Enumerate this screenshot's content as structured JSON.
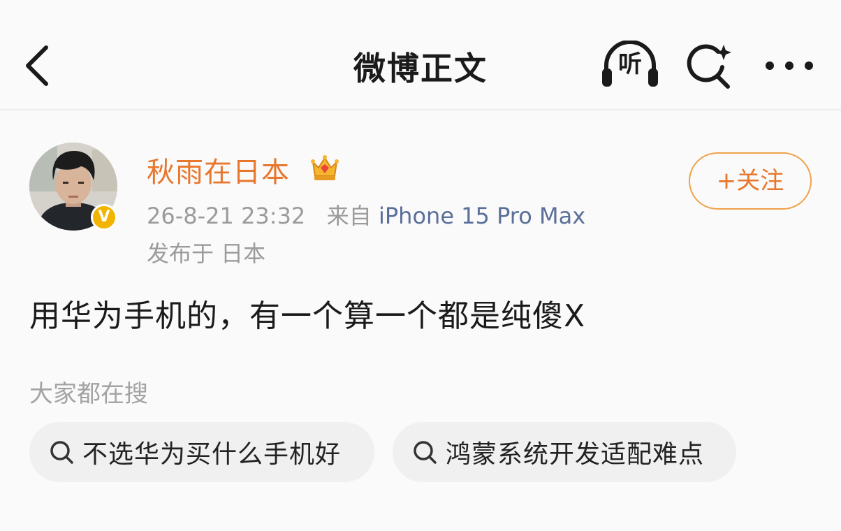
{
  "nav": {
    "title": "微博正文",
    "listen_label": "听"
  },
  "author": {
    "name": "秋雨在日本",
    "verified_mark": "V",
    "timestamp": "26-8-21 23:32",
    "source_prefix": "来自",
    "source_device": "iPhone 15 Pro Max",
    "location": "发布于 日本",
    "follow_label": "+关注"
  },
  "post": {
    "text": "用华为手机的，有一个算一个都是纯傻X"
  },
  "trending": {
    "label": "大家都在搜",
    "items": [
      {
        "text": "不选华为买什么手机好"
      },
      {
        "text": "鸿蒙系统开发适配难点"
      }
    ]
  },
  "colors": {
    "username": "#e8772e",
    "follow_border": "#f0a24a",
    "device_link": "#5a6f99",
    "meta_gray": "#9b9b9b",
    "chip_bg": "#f0f0f0",
    "verified_badge": "#f3b400"
  },
  "icons": {
    "back": "chevron-left-icon",
    "listen": "headphones-icon",
    "search": "sparkle-search-icon",
    "more": "more-dots-icon",
    "vip": "crown-icon",
    "chip": "search-icon"
  }
}
